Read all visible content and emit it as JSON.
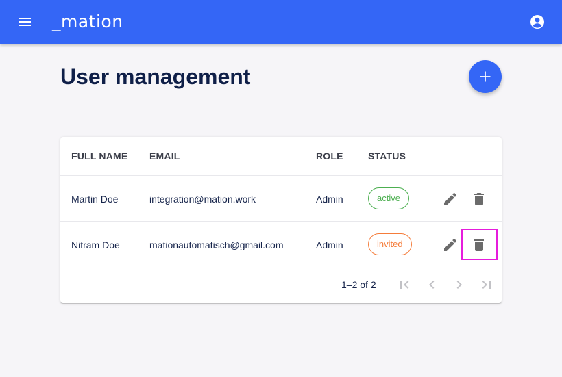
{
  "header": {
    "logo": "_mation",
    "menu_icon": "menu-icon",
    "account_icon": "account-circle-icon"
  },
  "page": {
    "title": "User management",
    "add_icon": "plus-icon"
  },
  "table": {
    "columns": [
      "FULL NAME",
      "EMAIL",
      "ROLE",
      "STATUS"
    ],
    "rows": [
      {
        "name": "Martin Doe",
        "email": "integration@mation.work",
        "role": "Admin",
        "status": "active"
      },
      {
        "name": "Nitram Doe",
        "email": "mationautomatisch@gmail.com",
        "role": "Admin",
        "status": "invited"
      }
    ],
    "pagination": {
      "range": "1–2 of 2",
      "icons": [
        "first-page-icon",
        "previous-page-icon",
        "next-page-icon",
        "last-page-icon"
      ]
    }
  },
  "colors": {
    "primary": "#3466f6",
    "active": "#4caf50",
    "invited": "#f57c3a",
    "icon_gray": "#6b6b6b",
    "focus": "#e61cdc"
  }
}
